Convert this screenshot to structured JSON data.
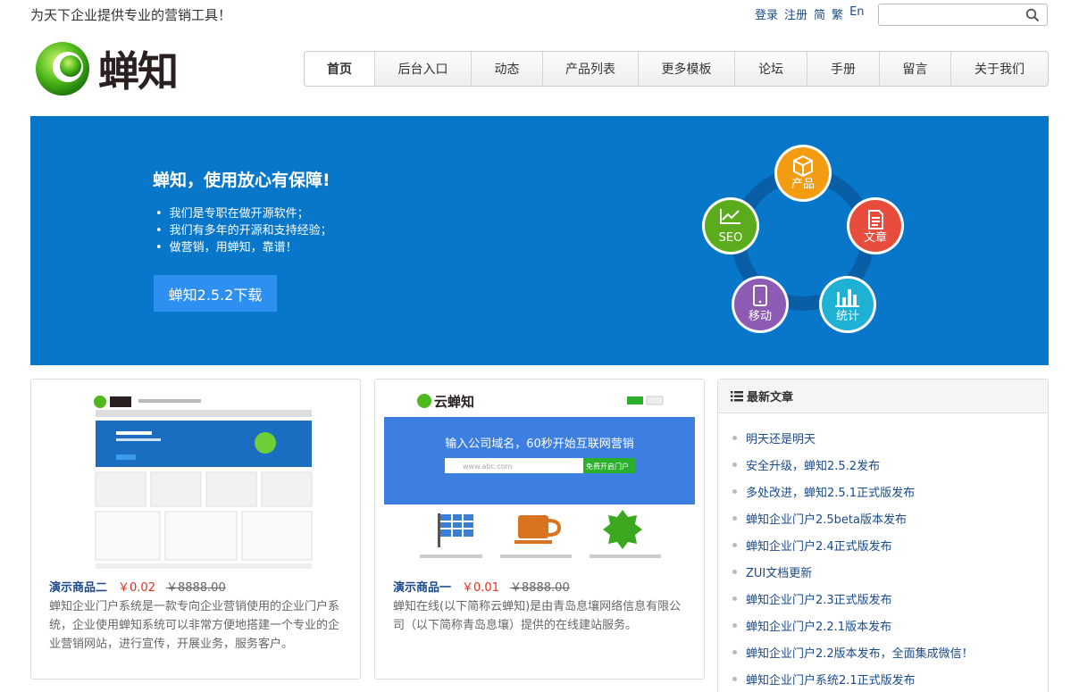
{
  "header": {
    "slogan": "为天下企业提供专业的营销工具！",
    "links": [
      "登录",
      "注册",
      "简",
      "繁",
      "En"
    ],
    "search_placeholder": "",
    "logo_text": "蝉知"
  },
  "nav": {
    "items": [
      {
        "label": "首页",
        "width": 79
      },
      {
        "label": "后台入口",
        "width": 108
      },
      {
        "label": "动态",
        "width": 80
      },
      {
        "label": "产品列表",
        "width": 107
      },
      {
        "label": "更多模板",
        "width": 108
      },
      {
        "label": "论坛",
        "width": 81
      },
      {
        "label": "手册",
        "width": 81
      },
      {
        "label": "留言",
        "width": 80
      },
      {
        "label": "关于我们",
        "width": 108
      }
    ],
    "active_index": 0
  },
  "banner": {
    "title": "蝉知，使用放心有保障!",
    "bullets": [
      "我们是专职在做开源软件；",
      "我们有多年的开源和支持经验；",
      "做营销，用蝉知，靠谱！"
    ],
    "download_label": "蝉知2.5.2下载",
    "features": [
      {
        "label": "产品",
        "color": "#f39c12"
      },
      {
        "label": "文章",
        "color": "#e74c3c"
      },
      {
        "label": "统计",
        "color": "#1fb1d4"
      },
      {
        "label": "移动",
        "color": "#8e5bb4"
      },
      {
        "label": "SEO",
        "color": "#5aac1c"
      }
    ]
  },
  "products": [
    {
      "name": "演示商品二",
      "price": "￥0.02",
      "original_price": "￥8888.00",
      "description": "蝉知企业门户系统是一款专向企业营销使用的企业门户系统，企业使用蝉知系统可以非常方便地搭建一个专业的企业营销网站，进行宣传，开展业务，服务客户。"
    },
    {
      "name": "演示商品一",
      "price": "￥0.01",
      "original_price": "￥8888.00",
      "description": "蝉知在线(以下简称云蝉知)是由青岛息壤网络信息有限公司（以下简称青岛息壤）提供的在线建站服务。",
      "thumb_logo": "云蝉知",
      "thumb_headline": "输入公司域名，60秒开始互联网营销",
      "thumb_input": "www.abc.com",
      "thumb_button": "免费开启门户"
    }
  ],
  "articles": {
    "title": "最新文章",
    "items": [
      "明天还是明天",
      "安全升级，蝉知2.5.2发布",
      "多处改进，蝉知2.5.1正式版发布",
      "蝉知企业门户2.5beta版本发布",
      "蝉知企业门户2.4正式版发布",
      "ZUI文档更新",
      "蝉知企业门户2.3正式版发布",
      "蝉知企业门户2.2.1版本发布",
      "蝉知企业门户2.2版本发布，全面集成微信！",
      "蝉知企业门户系统2.1正式版发布"
    ]
  }
}
